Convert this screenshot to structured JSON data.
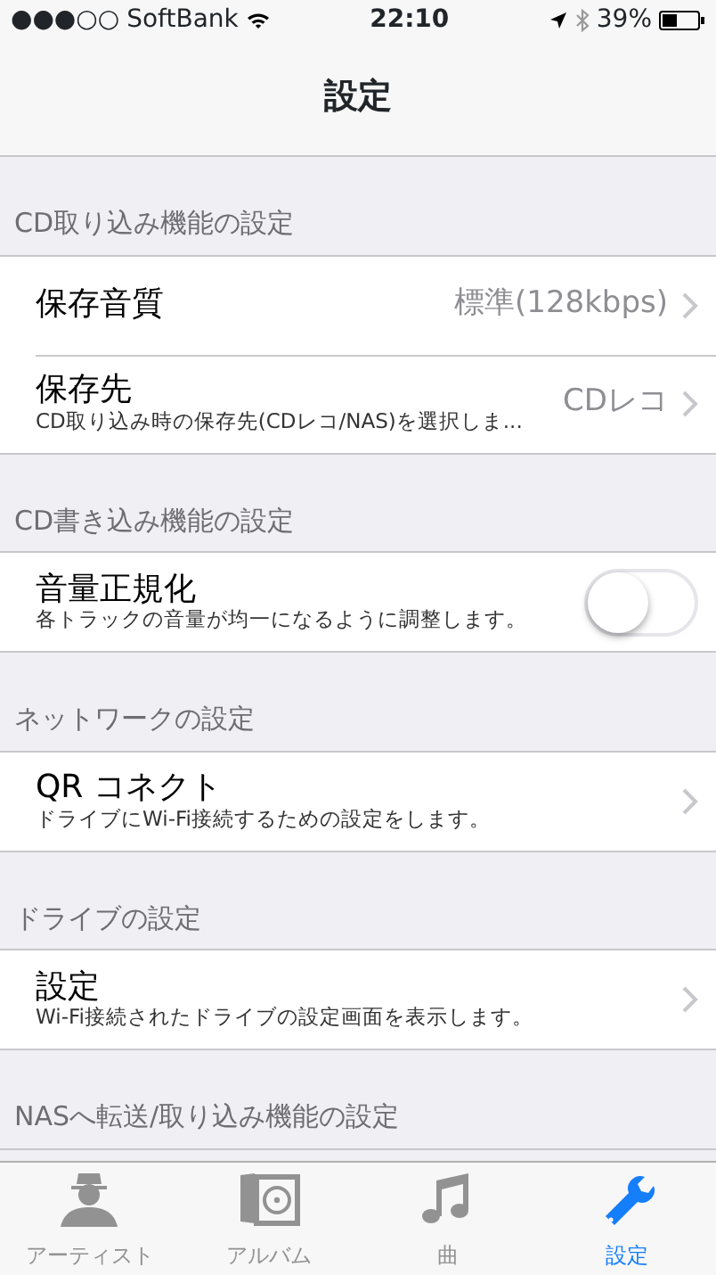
{
  "status_bar": {
    "signal": "●●●○○",
    "carrier": "SoftBank",
    "time": "22:10",
    "battery": "39%"
  },
  "nav": {
    "title": "設定"
  },
  "sections": [
    {
      "header": "CD取り込み機能の設定",
      "rows": [
        {
          "kind": "link",
          "title": "保存音質",
          "value": "標準(128kbps)"
        },
        {
          "kind": "link",
          "title": "保存先",
          "value": "CDレコ",
          "subtitle": "CD取り込み時の保存先(CDレコ/NAS)を選択しま..."
        }
      ]
    },
    {
      "header": "CD書き込み機能の設定",
      "rows": [
        {
          "kind": "toggle",
          "title": "音量正規化",
          "subtitle": "各トラックの音量が均一になるように調整します。",
          "on": false
        }
      ]
    },
    {
      "header": "ネットワークの設定",
      "rows": [
        {
          "kind": "link",
          "title": "QR コネクト",
          "subtitle": "ドライブにWi-Fi接続するための設定をします。"
        }
      ]
    },
    {
      "header": "ドライブの設定",
      "rows": [
        {
          "kind": "link",
          "title": "設定",
          "subtitle": "Wi-Fi接続されたドライブの設定画面を表示します。"
        }
      ]
    },
    {
      "header": "NASへ転送/取り込み機能の設定"
    }
  ],
  "tabs": [
    {
      "kind": "artist",
      "label": "アーティスト",
      "selected": false
    },
    {
      "kind": "album",
      "label": "アルバム",
      "selected": false
    },
    {
      "kind": "song",
      "label": "曲",
      "selected": false
    },
    {
      "kind": "settings",
      "label": "設定",
      "selected": true
    }
  ]
}
